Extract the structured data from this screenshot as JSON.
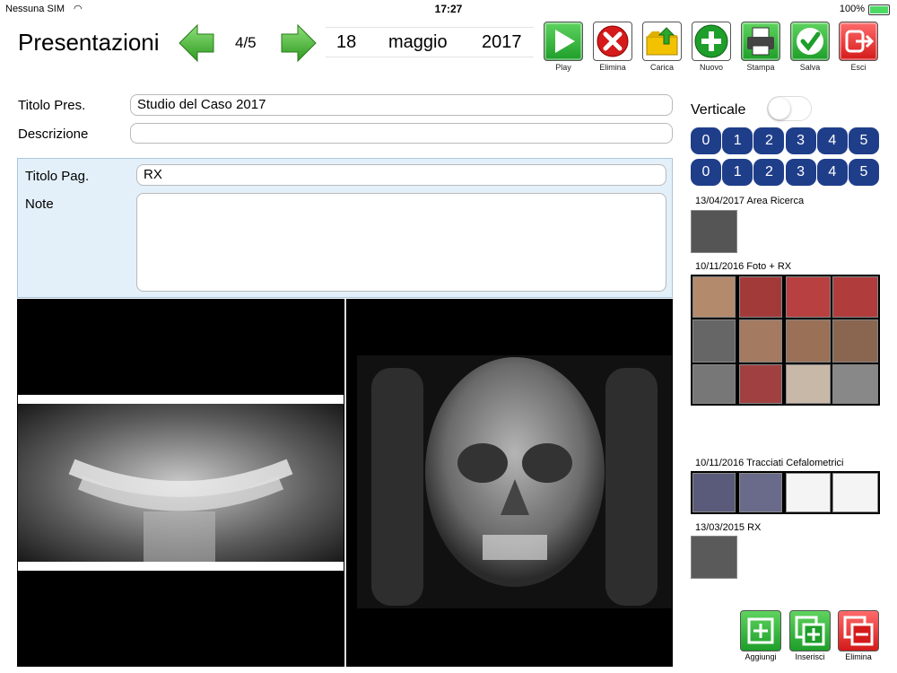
{
  "status": {
    "carrier": "Nessuna SIM",
    "time": "17:27",
    "battery_pct": "100%",
    "battery_level": 1.0
  },
  "header": {
    "title": "Presentazioni",
    "page_counter": "4/5",
    "date": {
      "day": "18",
      "month": "maggio",
      "year": "2017"
    }
  },
  "toolbar": [
    {
      "label": "Play",
      "icon": "play-icon"
    },
    {
      "label": "Elimina",
      "icon": "delete-icon"
    },
    {
      "label": "Carica",
      "icon": "upload-folder-icon"
    },
    {
      "label": "Nuovo",
      "icon": "plus-icon"
    },
    {
      "label": "Stampa",
      "icon": "print-icon"
    },
    {
      "label": "Salva",
      "icon": "check-icon"
    },
    {
      "label": "Esci",
      "icon": "exit-icon"
    }
  ],
  "form": {
    "title_label": "Titolo Pres.",
    "title_value": "Studio del Caso 2017",
    "desc_label": "Descrizione",
    "desc_value": "",
    "page_title_label": "Titolo Pag.",
    "page_title_value": "RX",
    "notes_label": "Note",
    "notes_value": ""
  },
  "sidebar": {
    "vertical_label": "Verticale",
    "vertical_on": false,
    "layout_row1": [
      "0",
      "1",
      "2",
      "3",
      "4",
      "5"
    ],
    "layout_row2": [
      "0",
      "1",
      "2",
      "3",
      "4",
      "5"
    ],
    "groups": [
      {
        "title": "13/04/2017 Area Ricerca"
      },
      {
        "title": "10/11/2016 Foto + RX"
      },
      {
        "title": "10/11/2016 Tracciati Cefalometrici"
      },
      {
        "title": "13/03/2015 RX"
      }
    ]
  },
  "bottom_actions": [
    {
      "label": "Aggiungi",
      "icon": "add-icon"
    },
    {
      "label": "Inserisci",
      "icon": "insert-icon"
    },
    {
      "label": "Elimina",
      "icon": "remove-icon"
    }
  ],
  "colors": {
    "accent_blue": "#1f3e8a",
    "panel_bg": "#e3f0fa",
    "green": "#1e9e2a",
    "red": "#d41a1a"
  }
}
